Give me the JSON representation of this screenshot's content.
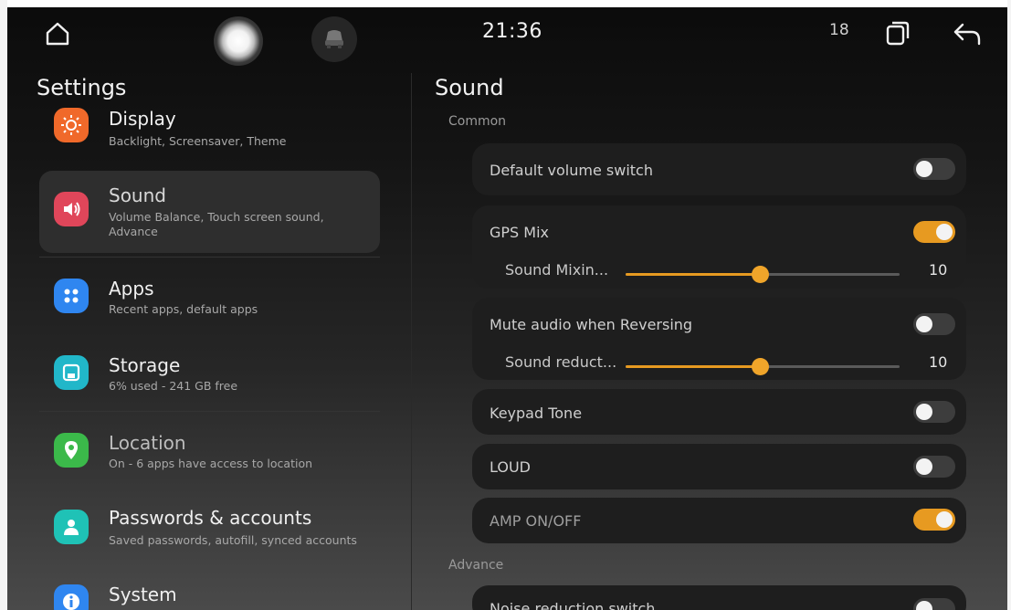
{
  "status_bar": {
    "time": "21:36",
    "notification_count": "18"
  },
  "left": {
    "title": "Settings",
    "items": [
      {
        "title": "Display",
        "subtitle": "Backlight, Screensaver, Theme",
        "icon": "sun-icon",
        "color": "#f0692a"
      },
      {
        "title": "Sound",
        "subtitle": "Volume Balance, Touch screen sound, Advance",
        "icon": "speaker-icon",
        "color": "#e0465a"
      },
      {
        "title": "Apps",
        "subtitle": "Recent apps, default apps",
        "icon": "grid-icon",
        "color": "#2f86f0"
      },
      {
        "title": "Storage",
        "subtitle": "6% used - 241 GB free",
        "icon": "floppy-icon",
        "color": "#21b7c9"
      },
      {
        "title": "Location",
        "subtitle": "On - 6 apps have access to location",
        "icon": "location-pin-icon",
        "color": "#3bb94a"
      },
      {
        "title": "Passwords & accounts",
        "subtitle": "Saved passwords, autofill, synced accounts",
        "icon": "person-icon",
        "color": "#1fc2b6"
      },
      {
        "title": "System",
        "subtitle": "",
        "icon": "info-icon",
        "color": "#2f86f0"
      }
    ]
  },
  "right": {
    "title": "Sound",
    "sections": {
      "common": "Common",
      "advance": "Advance"
    },
    "rows": {
      "default_volume": {
        "label": "Default volume switch",
        "on": false
      },
      "gps_mix": {
        "label": "GPS Mix",
        "on": true
      },
      "sound_mixing": {
        "label": "Sound Mixin...",
        "value": "10",
        "fraction": 0.49
      },
      "mute_reversing": {
        "label": "Mute audio when Reversing",
        "on": false
      },
      "sound_reduction": {
        "label": "Sound reduct...",
        "value": "10",
        "fraction": 0.49
      },
      "keypad_tone": {
        "label": "Keypad Tone",
        "on": false
      },
      "loud": {
        "label": "LOUD",
        "on": false
      },
      "amp": {
        "label": "AMP ON/OFF",
        "on": true
      },
      "noise_reduction": {
        "label": "Noise reduction switch",
        "on": false
      }
    },
    "accent_color": "#e79a21"
  }
}
